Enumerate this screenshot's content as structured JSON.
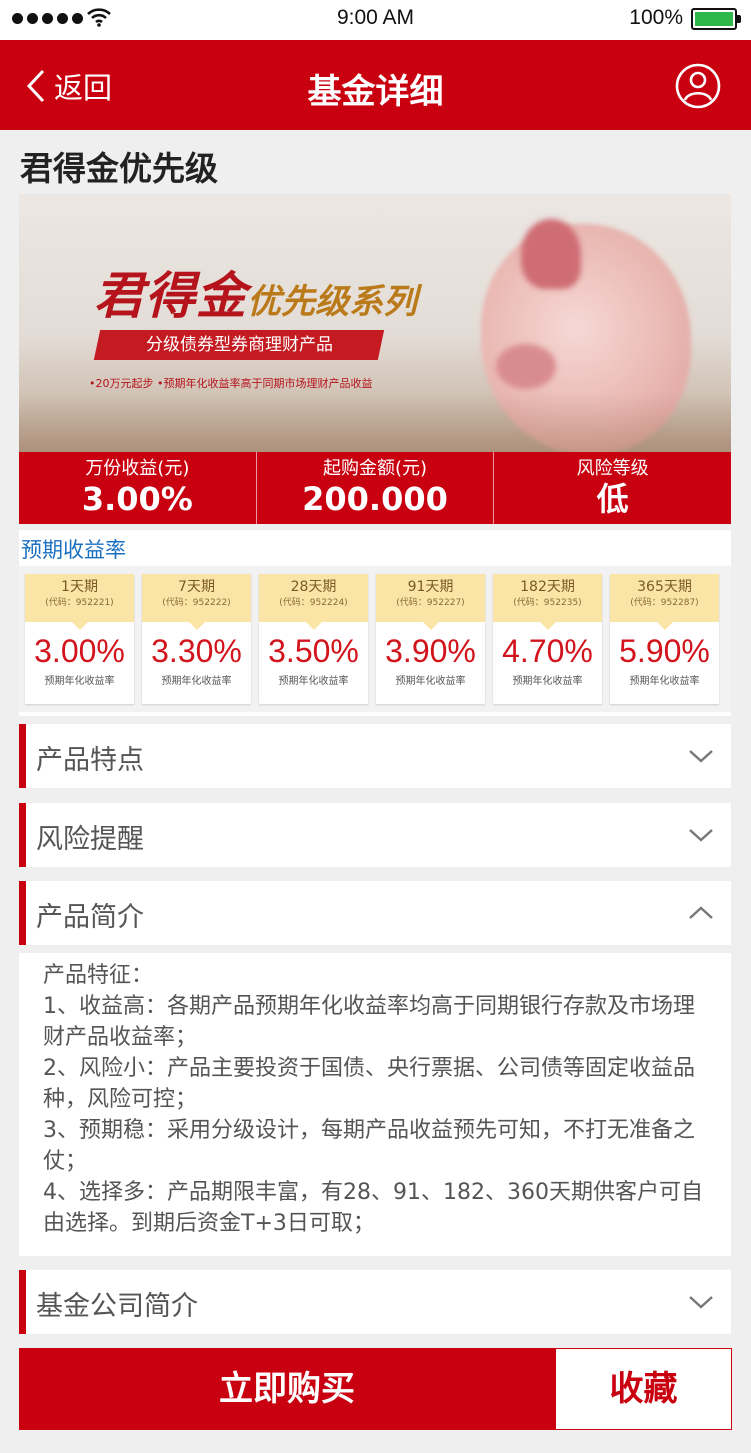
{
  "status_bar": {
    "time": "9:00  AM",
    "battery": "100%"
  },
  "header": {
    "back_label": "返回",
    "title": "基金详细"
  },
  "product_title": "君得金优先级",
  "banner": {
    "brand_main": "君得金",
    "brand_sub": "优先级系列",
    "ribbon": "分级债券型券商理财产品",
    "bullets": "•20万元起步   •预期年化收益率高于同期市场理财产品收益"
  },
  "info": [
    {
      "label": "万份收益(元)",
      "value": "3.00%"
    },
    {
      "label": "起购金额(元)",
      "value": "200.000"
    },
    {
      "label": "风险等级",
      "value": "低"
    }
  ],
  "yield": {
    "title": "预期收益率",
    "cards": [
      {
        "period": "1天期",
        "code": "(代码：952221)",
        "rate": "3.00%",
        "rate_label": "预期年化收益率"
      },
      {
        "period": "7天期",
        "code": "(代码：952222)",
        "rate": "3.30%",
        "rate_label": "预期年化收益率"
      },
      {
        "period": "28天期",
        "code": "(代码：952224)",
        "rate": "3.50%",
        "rate_label": "预期年化收益率"
      },
      {
        "period": "91天期",
        "code": "(代码：952227)",
        "rate": "3.90%",
        "rate_label": "预期年化收益率"
      },
      {
        "period": "182天期",
        "code": "(代码：952235)",
        "rate": "4.70%",
        "rate_label": "预期年化收益率"
      },
      {
        "period": "365天期",
        "code": "(代码：952287)",
        "rate": "5.90%",
        "rate_label": "预期年化收益率"
      }
    ]
  },
  "sections": {
    "features": "产品特点",
    "risk": "风险提醒",
    "intro": "产品简介",
    "company": "基金公司简介"
  },
  "intro_text": [
    "产品特征：",
    "1、收益高：各期产品预期年化收益率均高于同期银行存款及市场理财产品收益率；",
    "2、风险小：产品主要投资于国债、央行票据、公司债等固定收益品种，风险可控；",
    "3、预期稳：采用分级设计，每期产品收益预先可知，不打无准备之仗；",
    "4、选择多：产品期限丰富，有28、91、182、360天期供客户可自由选择。到期后资金T+3日可取；"
  ],
  "actions": {
    "buy": "立即购买",
    "favorite": "收藏"
  },
  "colors": {
    "brand_red": "#c8000f",
    "link_blue": "#1a6fc0",
    "card_header": "#fbe5a6"
  },
  "icons": {
    "back": "chevron-left-icon",
    "user": "user-circle-icon",
    "collapsed": "chevron-down-icon",
    "expanded": "chevron-up-icon"
  }
}
